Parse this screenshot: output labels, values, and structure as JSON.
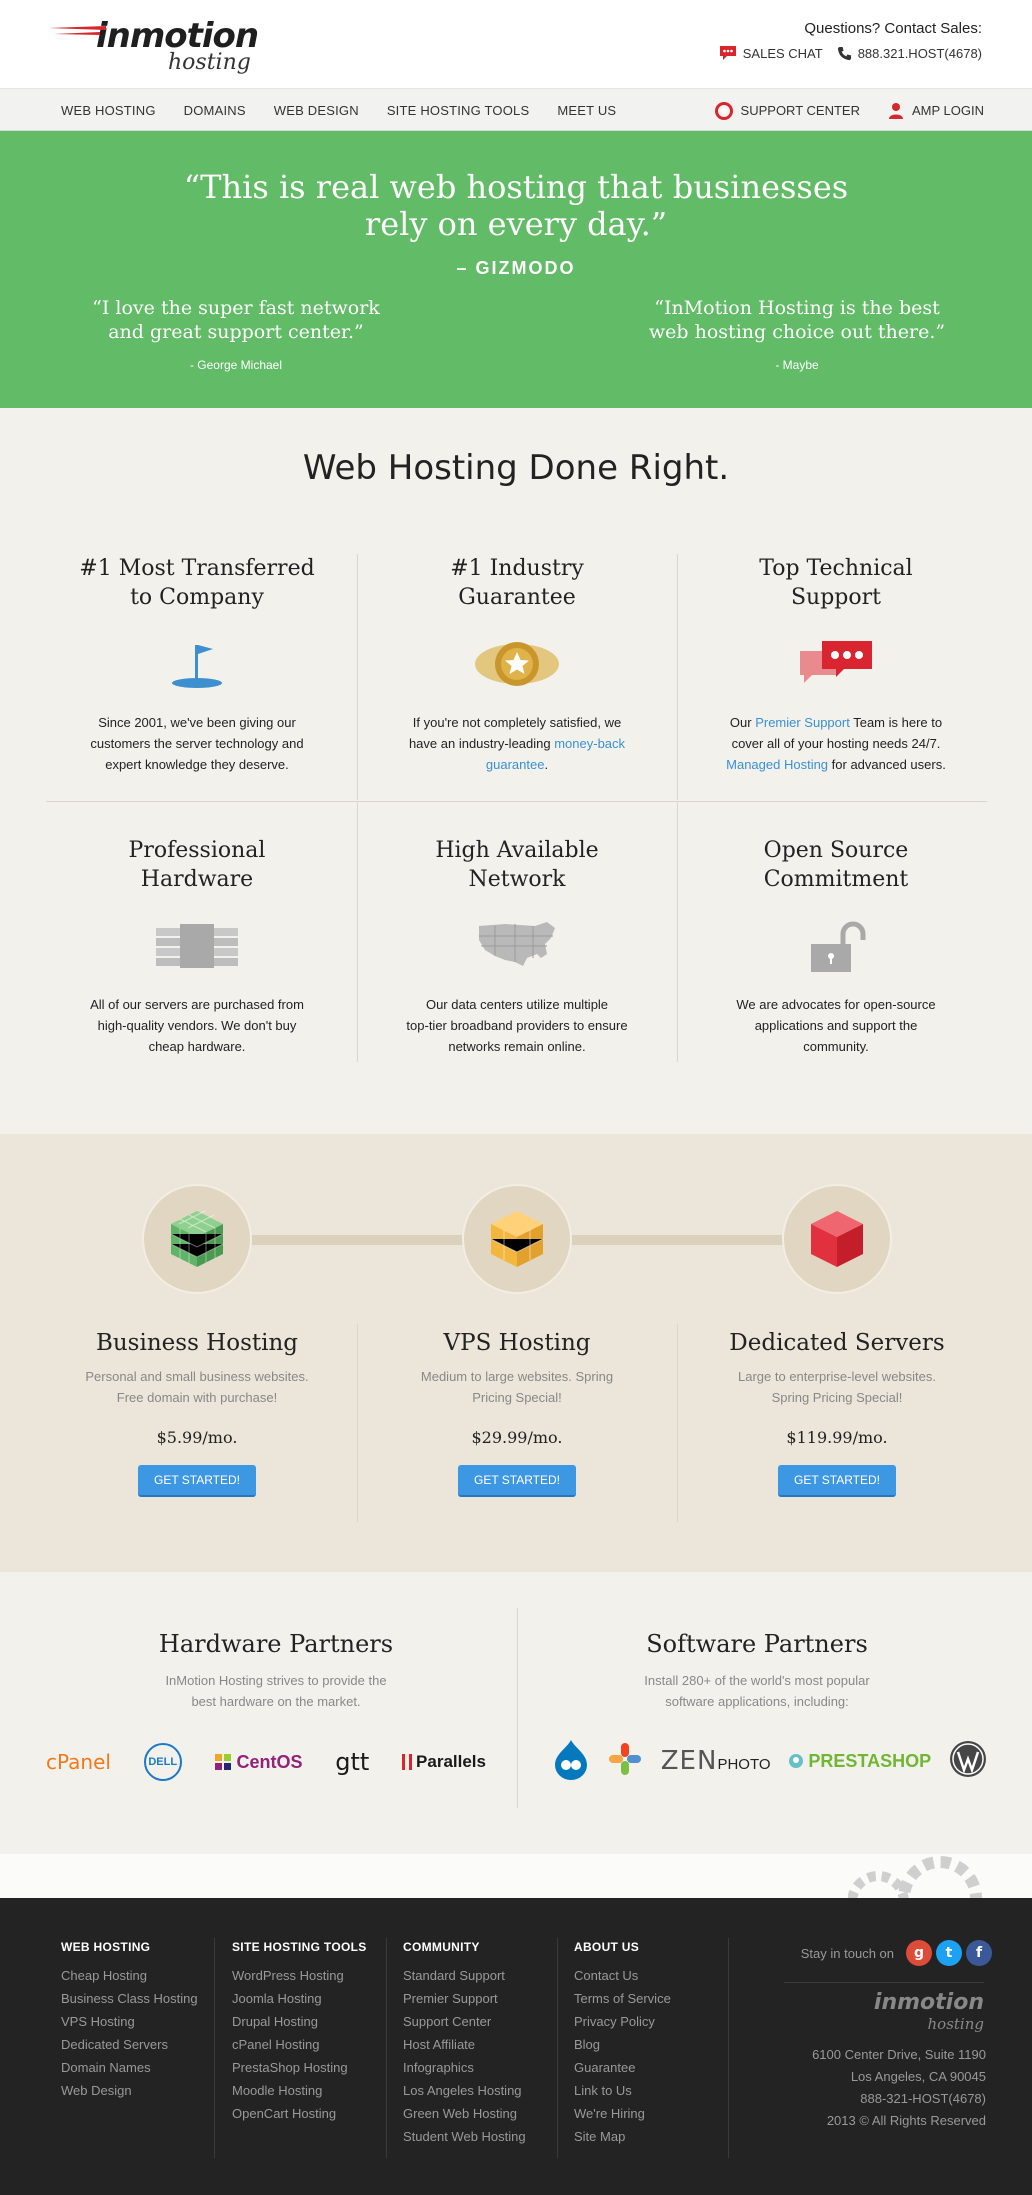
{
  "header": {
    "logo_word": "inmotion",
    "logo_sub": "hosting",
    "contact_title": "Questions? Contact Sales:",
    "chat_label": "SALES CHAT",
    "phone": "888.321.HOST(4678)"
  },
  "nav": {
    "items": [
      "WEB HOSTING",
      "DOMAINS",
      "WEB DESIGN",
      "SITE HOSTING TOOLS",
      "MEET US"
    ],
    "support": "SUPPORT CENTER",
    "login": "AMP LOGIN"
  },
  "testimonials": {
    "main_line1": "“This is real web hosting that businesses",
    "main_line2": "rely on every day.”",
    "main_source": "– GIZMODO",
    "left_line1": "“I love the super fast network",
    "left_line2": "and great support center.”",
    "left_author": "- George Michael",
    "right_line1": "“InMotion Hosting is the best",
    "right_line2": "web hosting choice out there.”",
    "right_author": "- Maybe"
  },
  "features": {
    "heading": "Web Hosting Done Right.",
    "items": [
      {
        "title1": "#1 Most Transferred",
        "title2": "to Company",
        "l1": "Since 2001, we've been giving our",
        "l2": "customers the server technology and",
        "l3": "expert knowledge they deserve."
      },
      {
        "title1": "#1 Industry",
        "title2": "Guarantee",
        "l1": "If you're not completely satisfied, we",
        "l2a": "have an industry-leading ",
        "l2link": "money-back",
        "l3link": "guarantee",
        "l3b": "."
      },
      {
        "title1": "Top Technical",
        "title2": "Support",
        "l1a": "Our ",
        "l1link": "Premier Support",
        "l1b": " Team is here to",
        "l2": "cover all of your hosting needs 24/7.",
        "l3link": "Managed Hosting",
        "l3b": " for advanced users."
      },
      {
        "title1": "Professional",
        "title2": "Hardware",
        "l1": "All of our servers are purchased from",
        "l2": "high-quality vendors. We don't buy",
        "l3": "cheap hardware."
      },
      {
        "title1": "High Available",
        "title2": "Network",
        "l1": "Our data centers utilize multiple",
        "l2": "top-tier broadband providers to ensure",
        "l3": "networks remain online."
      },
      {
        "title1": "Open Source",
        "title2": "Commitment",
        "l1": "We are advocates for open-source",
        "l2": "applications and support the",
        "l3": "community."
      }
    ]
  },
  "plans": [
    {
      "name": "Business Hosting",
      "d1": "Personal and small business websites.",
      "d2": "Free domain with purchase!",
      "price": "$5.99/mo.",
      "cta": "GET STARTED!",
      "color": "#5fb567"
    },
    {
      "name": "VPS Hosting",
      "d1": "Medium to large websites. Spring",
      "d2": "Pricing Special!",
      "price": "$29.99/mo.",
      "cta": "GET STARTED!",
      "color": "#f3b63e"
    },
    {
      "name": "Dedicated Servers",
      "d1": "Large to enterprise-level websites.",
      "d2": "Spring Pricing Special!",
      "price": "$119.99/mo.",
      "cta": "GET STARTED!",
      "color": "#e2313e"
    }
  ],
  "partners": {
    "hardware_title": "Hardware Partners",
    "hardware_d1": "InMotion Hosting strives to provide the",
    "hardware_d2": "best hardware on the market.",
    "hardware_logos": [
      "cPanel",
      "DELL",
      "CentOS",
      "gtt",
      "Parallels"
    ],
    "software_title": "Software Partners",
    "software_d1": "Install 280+ of the world's most popular",
    "software_d2": "software applications, including:",
    "software_logos": [
      "drupal-logo",
      "joomla-logo",
      "ZEN",
      "PHOTO",
      "PRESTASHOP",
      "wordpress-logo"
    ]
  },
  "footer": {
    "cols": [
      {
        "title": "WEB HOSTING",
        "links": [
          "Cheap Hosting",
          "Business Class Hosting",
          "VPS Hosting",
          "Dedicated Servers",
          "Domain Names",
          "Web Design"
        ]
      },
      {
        "title": "SITE HOSTING TOOLS",
        "links": [
          "WordPress Hosting",
          "Joomla Hosting",
          "Drupal Hosting",
          "cPanel Hosting",
          "PrestaShop Hosting",
          "Moodle Hosting",
          "OpenCart Hosting"
        ]
      },
      {
        "title": "COMMUNITY",
        "links": [
          "Standard Support",
          "Premier Support",
          "Support Center",
          "Host Affiliate",
          "Infographics",
          "Los Angeles Hosting",
          "Green Web Hosting",
          "Student Web Hosting"
        ]
      },
      {
        "title": "ABOUT US",
        "links": [
          "Contact Us",
          "Terms of Service",
          "Privacy Policy",
          "Blog",
          "Guarantee",
          "Link to Us",
          "We're Hiring",
          "Site Map"
        ]
      }
    ],
    "stay": "Stay in touch on",
    "logo_word": "inmotion",
    "logo_sub": "hosting",
    "addr1": "6100 Center Drive, Suite 1190",
    "addr2": "Los Angeles, CA 90045",
    "addr3": "888-321-HOST(4678)",
    "addr4": "2013 © All Rights Reserved"
  }
}
